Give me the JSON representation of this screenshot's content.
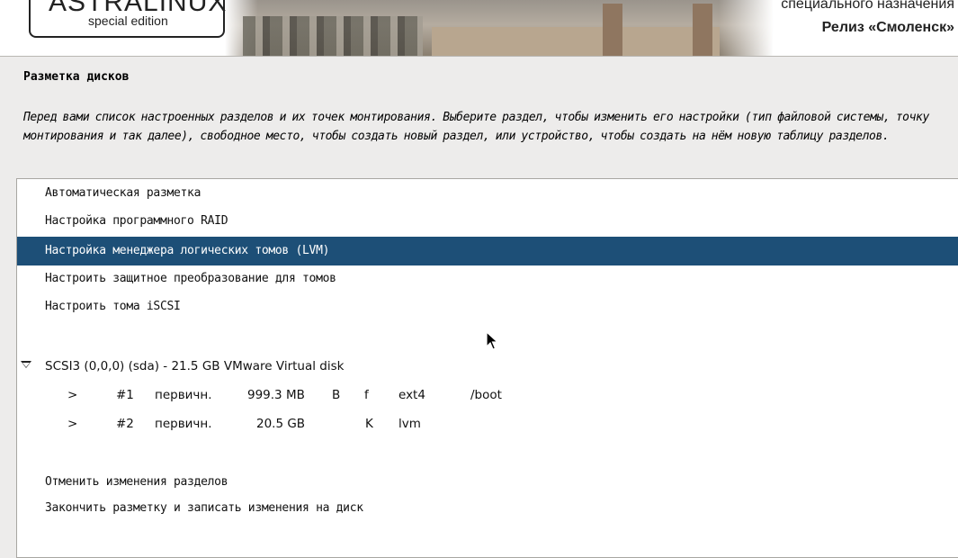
{
  "banner": {
    "logo_title": "ASTRALINUX",
    "logo_registered": "®",
    "logo_subtitle": "special edition",
    "line1": "специального назначения",
    "line2": "Релиз «Смоленск»"
  },
  "page": {
    "title": "Разметка дисков",
    "description": "Перед вами список настроенных разделов и их точек монтирования. Выберите раздел, чтобы изменить его настройки (тип файловой системы, точку монтирования и так далее), свободное место, чтобы создать новый раздел, или устройство, чтобы создать на нём новую таблицу разделов."
  },
  "list": {
    "actions": [
      {
        "label": "Автоматическая разметка"
      },
      {
        "label": "Настройка программного RAID"
      },
      {
        "label": "Настройка менеджера логических томов (LVM)"
      },
      {
        "label": "Настроить защитное преобразование для томов"
      },
      {
        "label": "Настроить тома iSCSI"
      }
    ],
    "disk": {
      "label": "SCSI3 (0,0,0) (sda) - 21.5 GB VMware Virtual disk",
      "partitions": [
        {
          "arrow": ">",
          "num": "#1",
          "type": "первичн.",
          "size": "999.3 MB",
          "flag1": "B",
          "flag2": "f",
          "fs": "ext4",
          "mount": "/boot"
        },
        {
          "arrow": ">",
          "num": "#2",
          "type": "первичн.",
          "size": "20.5 GB",
          "flag1": "",
          "flag2": "K",
          "fs": "lvm",
          "mount": ""
        }
      ]
    },
    "footer_actions": [
      {
        "label": "Отменить изменения разделов"
      },
      {
        "label": "Закончить разметку и записать изменения на диск"
      }
    ]
  },
  "icons": {
    "disk_toggle": "triangle-down-icon",
    "cursor": "mouse-pointer-icon"
  },
  "colors": {
    "selection": "#1d4f77",
    "background": "#edeceb"
  }
}
